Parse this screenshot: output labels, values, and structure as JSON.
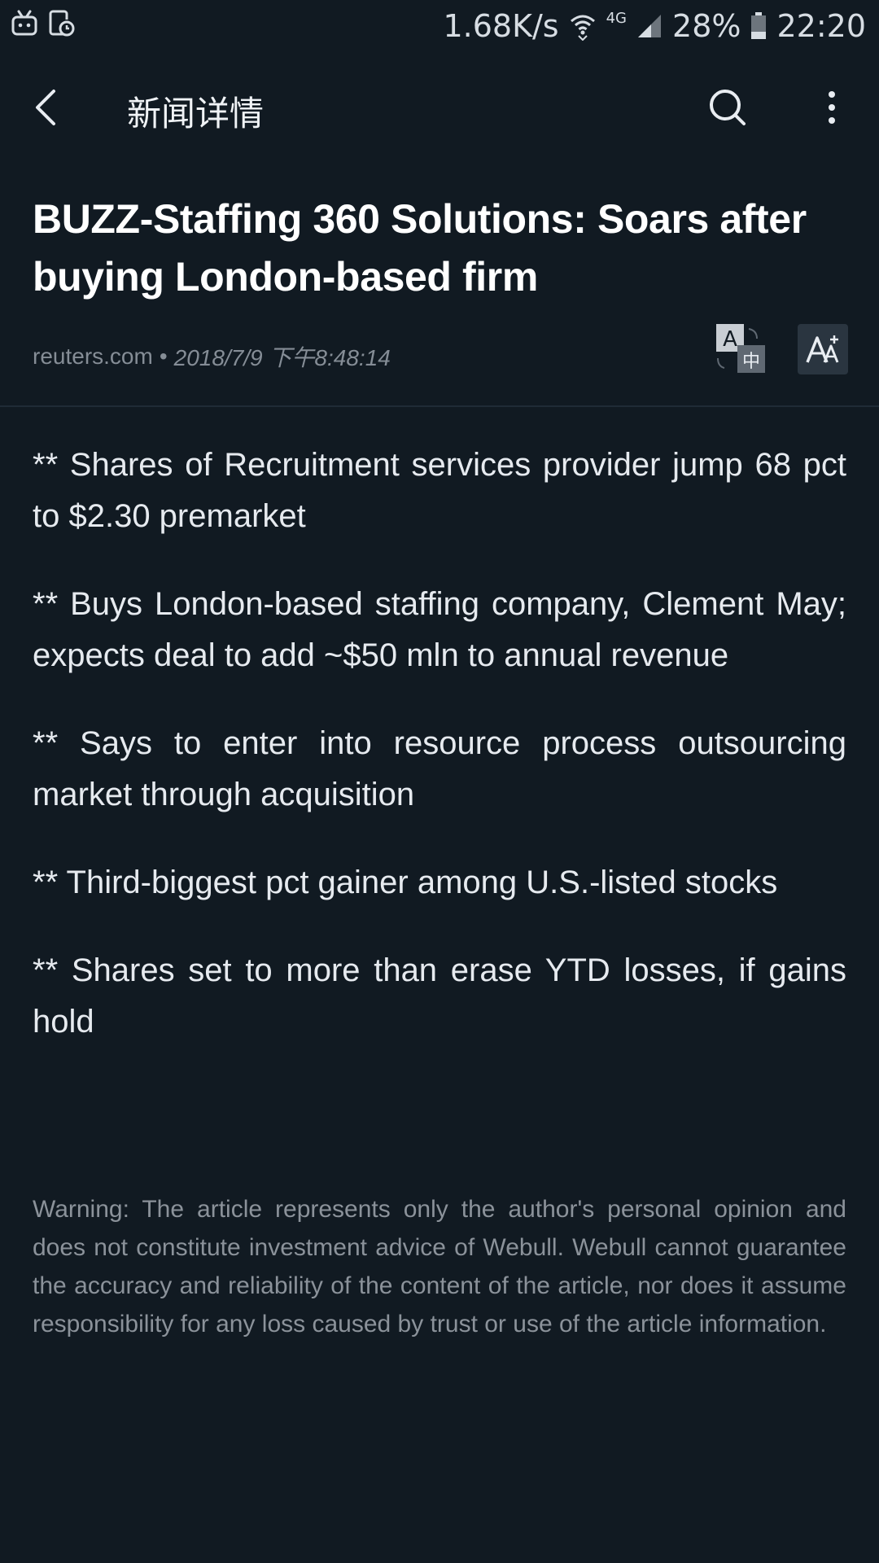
{
  "status_bar": {
    "speed": "1.68K/s",
    "network": "4G",
    "battery": "28%",
    "time": "22:20"
  },
  "app_bar": {
    "title": "新闻详情"
  },
  "article": {
    "headline": "BUZZ-Staffing 360 Solutions: Soars after buying London-based firm",
    "source": "reuters.com",
    "separator": "•",
    "date": "2018/7/9 下午8:48:14",
    "translate_glyphs": {
      "latin": "A",
      "cjk": "中"
    },
    "paragraphs": [
      "** Shares of Recruitment services provider jump 68 pct to $2.30 premarket",
      "** Buys London-based staffing company, Clement May; expects deal to add ~$50 mln to annual revenue",
      "** Says to enter into resource process outsourcing market through acquisition",
      "** Third-biggest pct gainer among U.S.-listed stocks",
      "** Shares set to more than erase YTD losses, if gains hold"
    ],
    "warning": "Warning: The article represents only the author's personal opinion and does not constitute investment advice of Webull. Webull cannot guarantee the accuracy and reliability of the content of the article, nor does it assume responsibility for any loss caused by trust or use of the article information."
  },
  "colors": {
    "background": "#111a22",
    "text_primary": "#ffffff",
    "text_secondary": "#858d96"
  }
}
